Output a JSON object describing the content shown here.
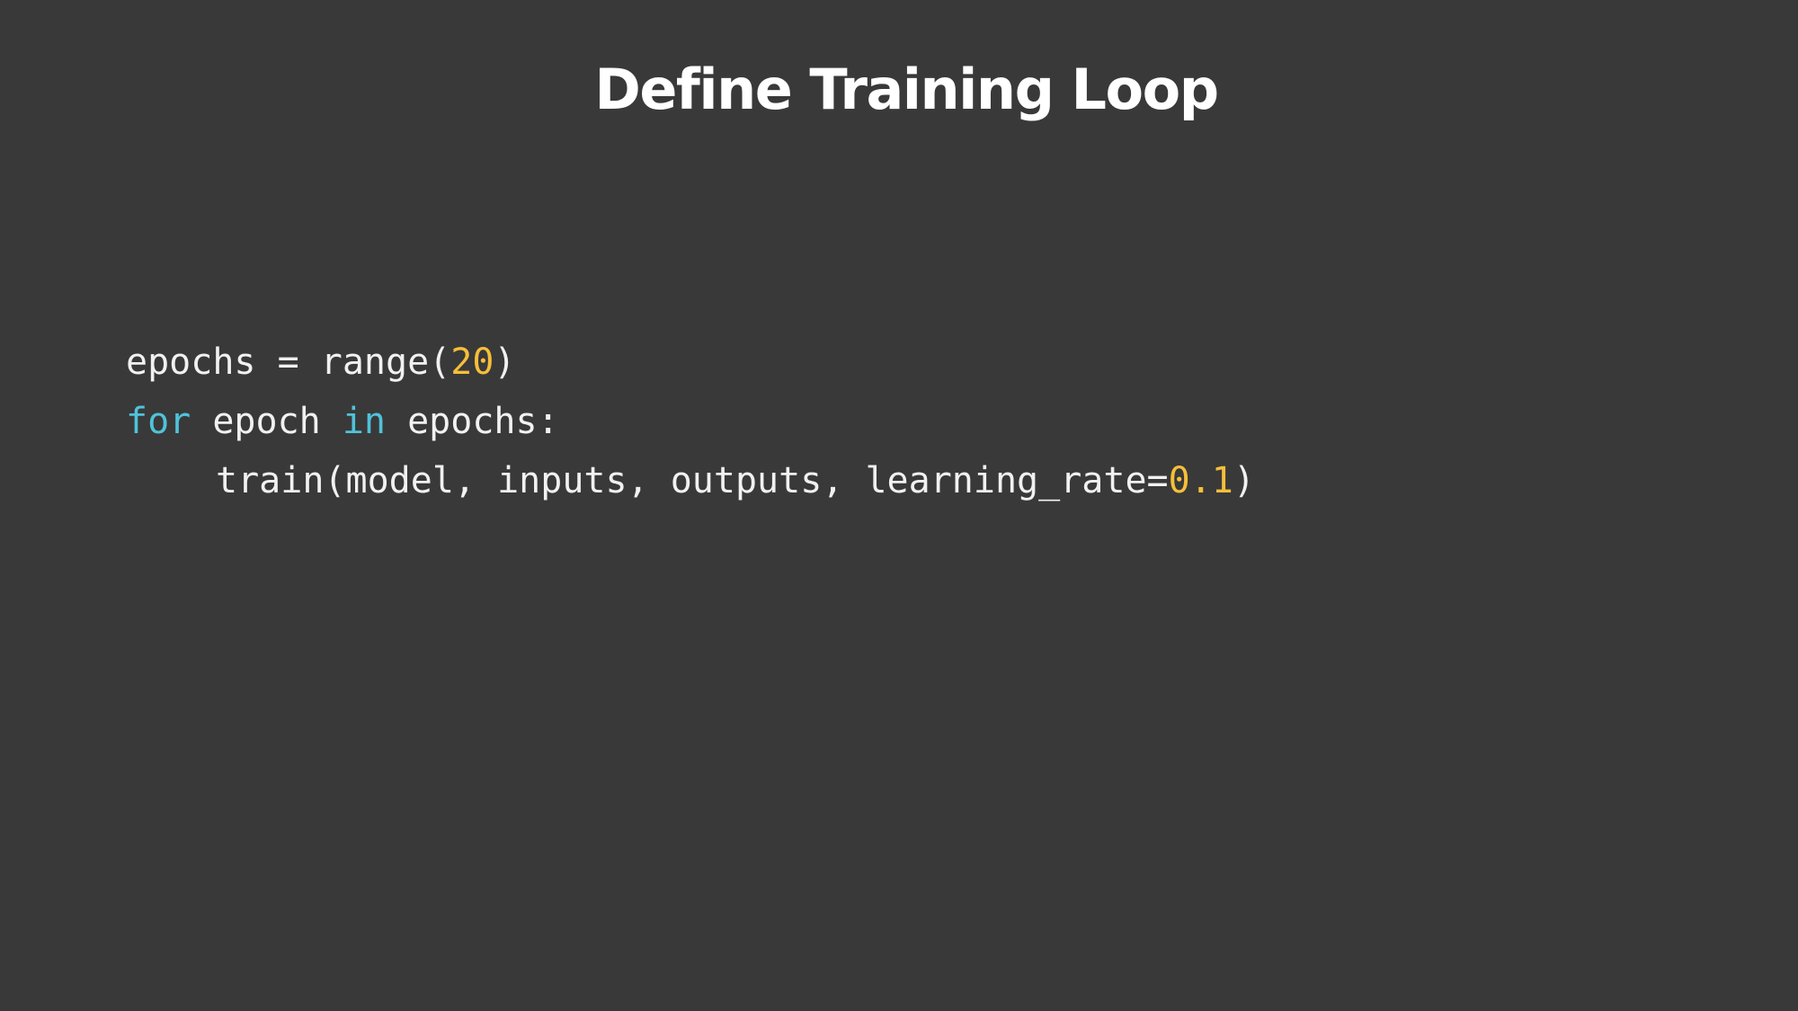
{
  "slide": {
    "title": "Define Training Loop"
  },
  "code": {
    "line1": {
      "a": "epochs = range(",
      "num": "20",
      "b": ")"
    },
    "line2": {
      "kw1": "for",
      "a": " epoch ",
      "kw2": "in",
      "b": " epochs:"
    },
    "line3": {
      "a": "train(model, inputs, outputs, learning_rate=",
      "num": "0.1",
      "b": ")"
    }
  },
  "colors": {
    "background": "#393939",
    "text": "#f1f1f1",
    "keyword": "#4fc3d9",
    "number": "#f6bf3a",
    "title": "#ffffff"
  }
}
